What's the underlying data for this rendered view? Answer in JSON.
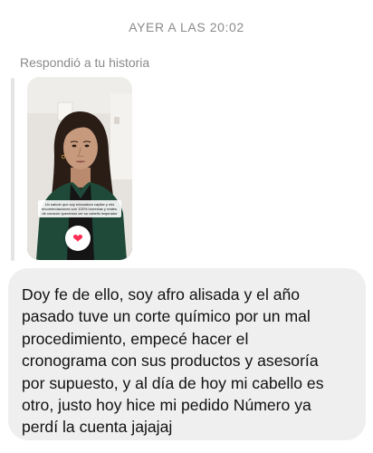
{
  "conversation": {
    "timestamp": "AYER A LAS 20:02",
    "reply_label": "Respondió a tu historia",
    "story": {
      "caption": "Un saludo que soy educadora capilar y mis recomendaciones son 100% honestas y reales. de corazón queremos ver su cabello inspirador",
      "reaction_icon": "heart-icon",
      "reaction_glyph": "❤",
      "reaction_color": "#ff2d55"
    },
    "message": {
      "text": "Doy fe de ello, soy afro alisada y el año\npasado tuve un corte químico por un mal\nprocedimiento, empecé hacer el\ncronograma con sus productos y asesoría\npor supuesto, y al día de hoy mi cabello es\notro, justo hoy hice mi pedido Número ya\nperdí la cuenta jajajaj",
      "bubble_color": "#efefef"
    }
  }
}
